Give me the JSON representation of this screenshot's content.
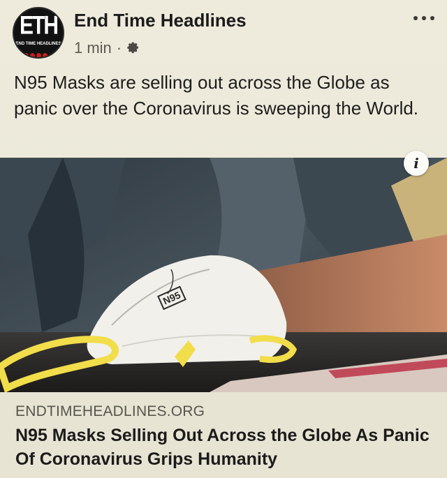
{
  "page": {
    "name": "End Time Headlines",
    "avatar_text": "ETH",
    "avatar_tagline": "END TIME HEADLINES",
    "timestamp": "1 min",
    "separator": "·",
    "audience_icon": "gear-icon",
    "more_icon": "more-options-icon"
  },
  "post": {
    "text": "N95 Masks are selling out across the Globe as panic over the Coronavirus is sweeping the World."
  },
  "image": {
    "mask_label": "N95",
    "info_label": "i"
  },
  "link": {
    "domain": "ENDTIMEHEADLINES.ORG",
    "title": "N95 Masks Selling Out Across the Globe As Panic Of Coronavirus Grips Humanity"
  },
  "colors": {
    "background": "#eeebdd",
    "mask_strap": "#f2dd4a",
    "avatar_accent": "#c81e1e"
  }
}
